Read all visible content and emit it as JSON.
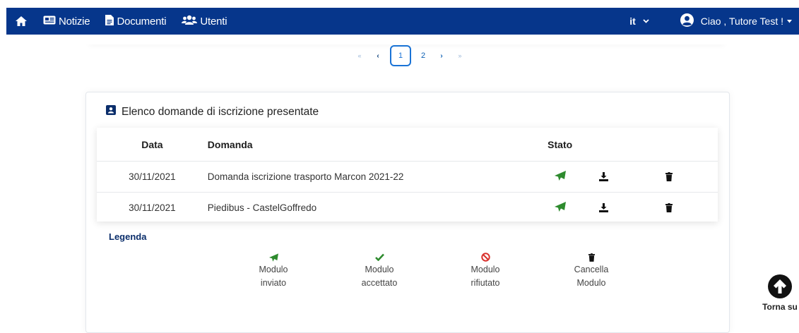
{
  "nav": {
    "links": [
      {
        "label": "Notizie",
        "icon": "newspaper-icon"
      },
      {
        "label": "Documenti",
        "icon": "document-icon"
      },
      {
        "label": "Utenti",
        "icon": "users-icon"
      }
    ],
    "language": "it",
    "user_greeting": "Ciao , Tutore Test !",
    "background_color": "#06368b"
  },
  "pagination": {
    "first": "«",
    "prev": "‹",
    "pages": [
      "1",
      "2"
    ],
    "current": "1",
    "next": "›",
    "last": "»"
  },
  "card": {
    "title": "Elenco domande di iscrizione presentate",
    "columns": {
      "data": "Data",
      "domanda": "Domanda",
      "stato": "Stato"
    },
    "rows": [
      {
        "data": "30/11/2021",
        "domanda": "Domanda iscrizione trasporto Marcon 2021-22",
        "stato": "Modulo inviato"
      },
      {
        "data": "30/11/2021",
        "domanda": "Piedibus - CastelGoffredo",
        "stato": "Modulo inviato"
      }
    ]
  },
  "legend": {
    "title": "Legenda",
    "items": [
      {
        "line1": "Modulo",
        "line2": "inviato",
        "icon": "paper-plane-icon",
        "color": "#2e8b2e"
      },
      {
        "line1": "Modulo",
        "line2": "accettato",
        "icon": "check-icon",
        "color": "#2e8b2e"
      },
      {
        "line1": "Modulo",
        "line2": "rifiutato",
        "icon": "ban-icon",
        "color": "#d9302c"
      },
      {
        "line1": "Cancella",
        "line2": "Modulo",
        "icon": "trash-icon",
        "color": "#111111"
      }
    ]
  },
  "back_to_top": {
    "label": "Torna su"
  },
  "colors": {
    "accent": "#1a73d6",
    "sent": "#2e8b2e",
    "rejected": "#d9302c"
  }
}
